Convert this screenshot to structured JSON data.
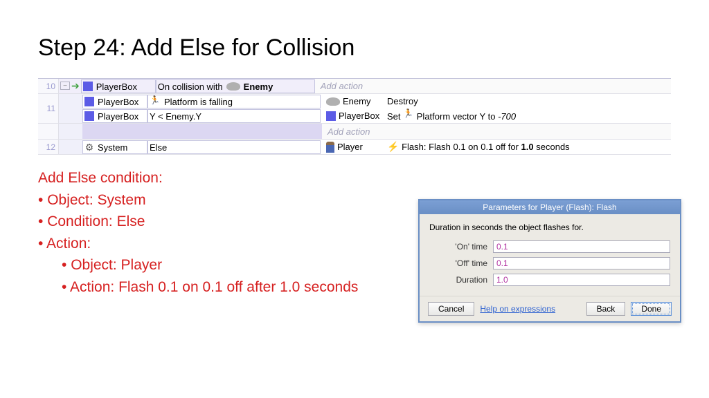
{
  "title": "Step 24: Add Else for Collision",
  "events": {
    "row10": {
      "num": "10",
      "obj": "PlayerBox",
      "cond": "On collision with",
      "target": "Enemy",
      "add": "Add action"
    },
    "row11": {
      "num": "11",
      "c1_obj": "PlayerBox",
      "c1_text": "Platform is falling",
      "c2_obj": "PlayerBox",
      "c2_text": "Y < Enemy.Y",
      "a1_obj": "Enemy",
      "a1_text": "Destroy",
      "a2_obj": "PlayerBox",
      "a2_text_pre": "Set",
      "a2_text_mid": "Platform vector Y to",
      "a2_val": "-700",
      "add": "Add action"
    },
    "row12": {
      "num": "12",
      "obj": "System",
      "cond": "Else",
      "a_obj": "Player",
      "a_text": "Flash: Flash 0.1 on 0.1 off for",
      "a_val": "1.0",
      "a_suffix": "seconds"
    }
  },
  "instr": {
    "head": "Add Else condition:",
    "l1": "Object: System",
    "l2": "Condition: Else",
    "l3": "Action:",
    "s1": "Object: Player",
    "s2": "Action: Flash 0.1 on 0.1 off after 1.0    seconds"
  },
  "dialog": {
    "title": "Parameters for Player (Flash): Flash",
    "desc": "Duration in seconds the object flashes for.",
    "f1_lbl": "'On' time",
    "f1_val": "0.1",
    "f2_lbl": "'Off' time",
    "f2_val": "0.1",
    "f3_lbl": "Duration",
    "f3_val": "1.0",
    "cancel": "Cancel",
    "help": "Help on expressions",
    "back": "Back",
    "done": "Done"
  }
}
